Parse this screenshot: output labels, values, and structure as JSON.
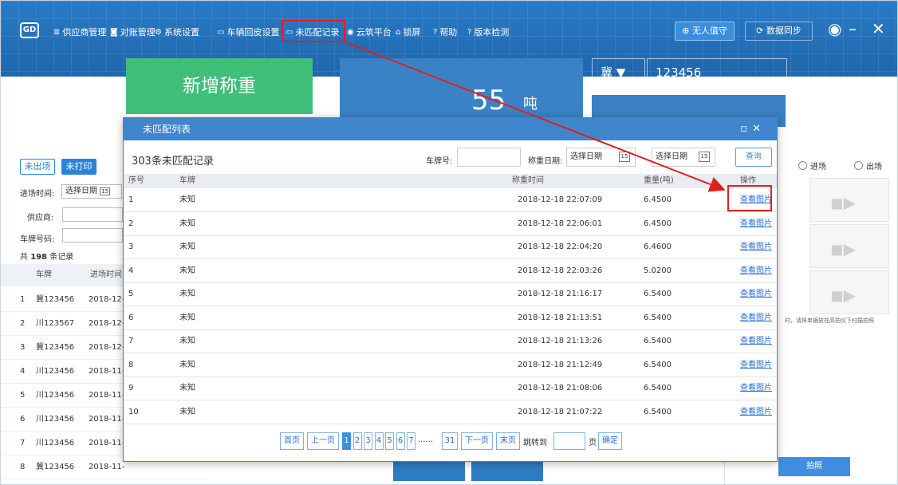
{
  "toolbar": {
    "logo_text": "GD",
    "menu": [
      {
        "icon": "≣",
        "label": "供应商管理"
      },
      {
        "icon": "◙",
        "label": "对账管理"
      },
      {
        "icon": "⚙",
        "label": "系统设置"
      },
      {
        "icon": "▭",
        "label": "车辆回皮设置"
      },
      {
        "icon": "▭",
        "label": "未匹配记录"
      },
      {
        "icon": "◉",
        "label": "云筑平台"
      },
      {
        "icon": "⌂",
        "label": "锁屏"
      },
      {
        "icon": "?",
        "label": "帮助"
      },
      {
        "icon": "?",
        "label": "版本检测"
      }
    ],
    "unattended_label": "无人值守",
    "sync_label": "数据同步",
    "minimize": "–",
    "close": "✕"
  },
  "weigh": {
    "new_weigh_label": "新增称重",
    "weight_value": "55",
    "weight_unit": "吨",
    "province": "冀 ▼",
    "plate": "123456"
  },
  "left": {
    "tabs": [
      "未出场",
      "未打印"
    ],
    "entry_time_label": "进场时间:",
    "date_placeholder": "选择日期",
    "supplier_label": "供应商:",
    "plate_label": "车牌号码:",
    "total_prefix": "共",
    "total_count": "198",
    "total_suffix": "条记录",
    "col_plate": "车牌",
    "col_time": "进场时间",
    "rows": [
      {
        "no": "1",
        "plate": "冀123456",
        "time": "2018-12-"
      },
      {
        "no": "2",
        "plate": "川123567",
        "time": "2018-12-"
      },
      {
        "no": "3",
        "plate": "冀123456",
        "time": "2018-12-"
      },
      {
        "no": "4",
        "plate": "川123456",
        "time": "2018-11-"
      },
      {
        "no": "5",
        "plate": "川123456",
        "time": "2018-11-"
      },
      {
        "no": "6",
        "plate": "川123456",
        "time": "2018-11-"
      },
      {
        "no": "7",
        "plate": "川123456",
        "time": "2018-11-"
      },
      {
        "no": "8",
        "plate": "冀123456",
        "time": "2018-11-"
      }
    ]
  },
  "right": {
    "radio_in": "进场",
    "radio_out": "出场",
    "hint": "时，请将单据放在高拍仪下扫描拍照",
    "snap_label": "拍照"
  },
  "modal": {
    "title": "未匹配列表",
    "count_text": "303条未匹配记录",
    "plate_filter_label": "车牌号:",
    "weigh_date_label": "称重日期:",
    "date_placeholder_1": "选择日期",
    "date_placeholder_2": "选择日期",
    "query_label": "查询",
    "columns": [
      "序号",
      "车牌",
      "称重时间",
      "重量(吨)",
      "操作"
    ],
    "rows": [
      {
        "no": "1",
        "plate": "未知",
        "time": "2018-12-18 22:07:09",
        "weight": "6.4500",
        "action": "查看图片"
      },
      {
        "no": "2",
        "plate": "未知",
        "time": "2018-12-18 22:06:01",
        "weight": "6.4500",
        "action": "查看图片"
      },
      {
        "no": "3",
        "plate": "未知",
        "time": "2018-12-18 22:04:20",
        "weight": "6.4600",
        "action": "查看图片"
      },
      {
        "no": "4",
        "plate": "未知",
        "time": "2018-12-18 22:03:26",
        "weight": "5.0200",
        "action": "查看图片"
      },
      {
        "no": "5",
        "plate": "未知",
        "time": "2018-12-18 21:16:17",
        "weight": "6.5400",
        "action": "查看图片"
      },
      {
        "no": "6",
        "plate": "未知",
        "time": "2018-12-18 21:13:51",
        "weight": "6.5400",
        "action": "查看图片"
      },
      {
        "no": "7",
        "plate": "未知",
        "time": "2018-12-18 21:13:26",
        "weight": "6.5400",
        "action": "查看图片"
      },
      {
        "no": "8",
        "plate": "未知",
        "time": "2018-12-18 21:12:49",
        "weight": "6.5400",
        "action": "查看图片"
      },
      {
        "no": "9",
        "plate": "未知",
        "time": "2018-12-18 21:08:06",
        "weight": "6.5400",
        "action": "查看图片"
      },
      {
        "no": "10",
        "plate": "未知",
        "time": "2018-12-18 21:07:22",
        "weight": "6.5400",
        "action": "查看图片"
      }
    ],
    "pager": {
      "first": "首页",
      "prev": "上一页",
      "pages": [
        "1",
        "2",
        "3",
        "4",
        "5",
        "6",
        "7"
      ],
      "ellipsis": "......",
      "last_page": "31",
      "next": "下一页",
      "end": "末页",
      "jump_label": "跳转到",
      "page_unit": "页",
      "confirm": "确定"
    }
  },
  "colors": {
    "primary": "#2470b8",
    "green": "#3fbf7a",
    "highlight": "#e02020",
    "link": "#2a6fd6"
  }
}
